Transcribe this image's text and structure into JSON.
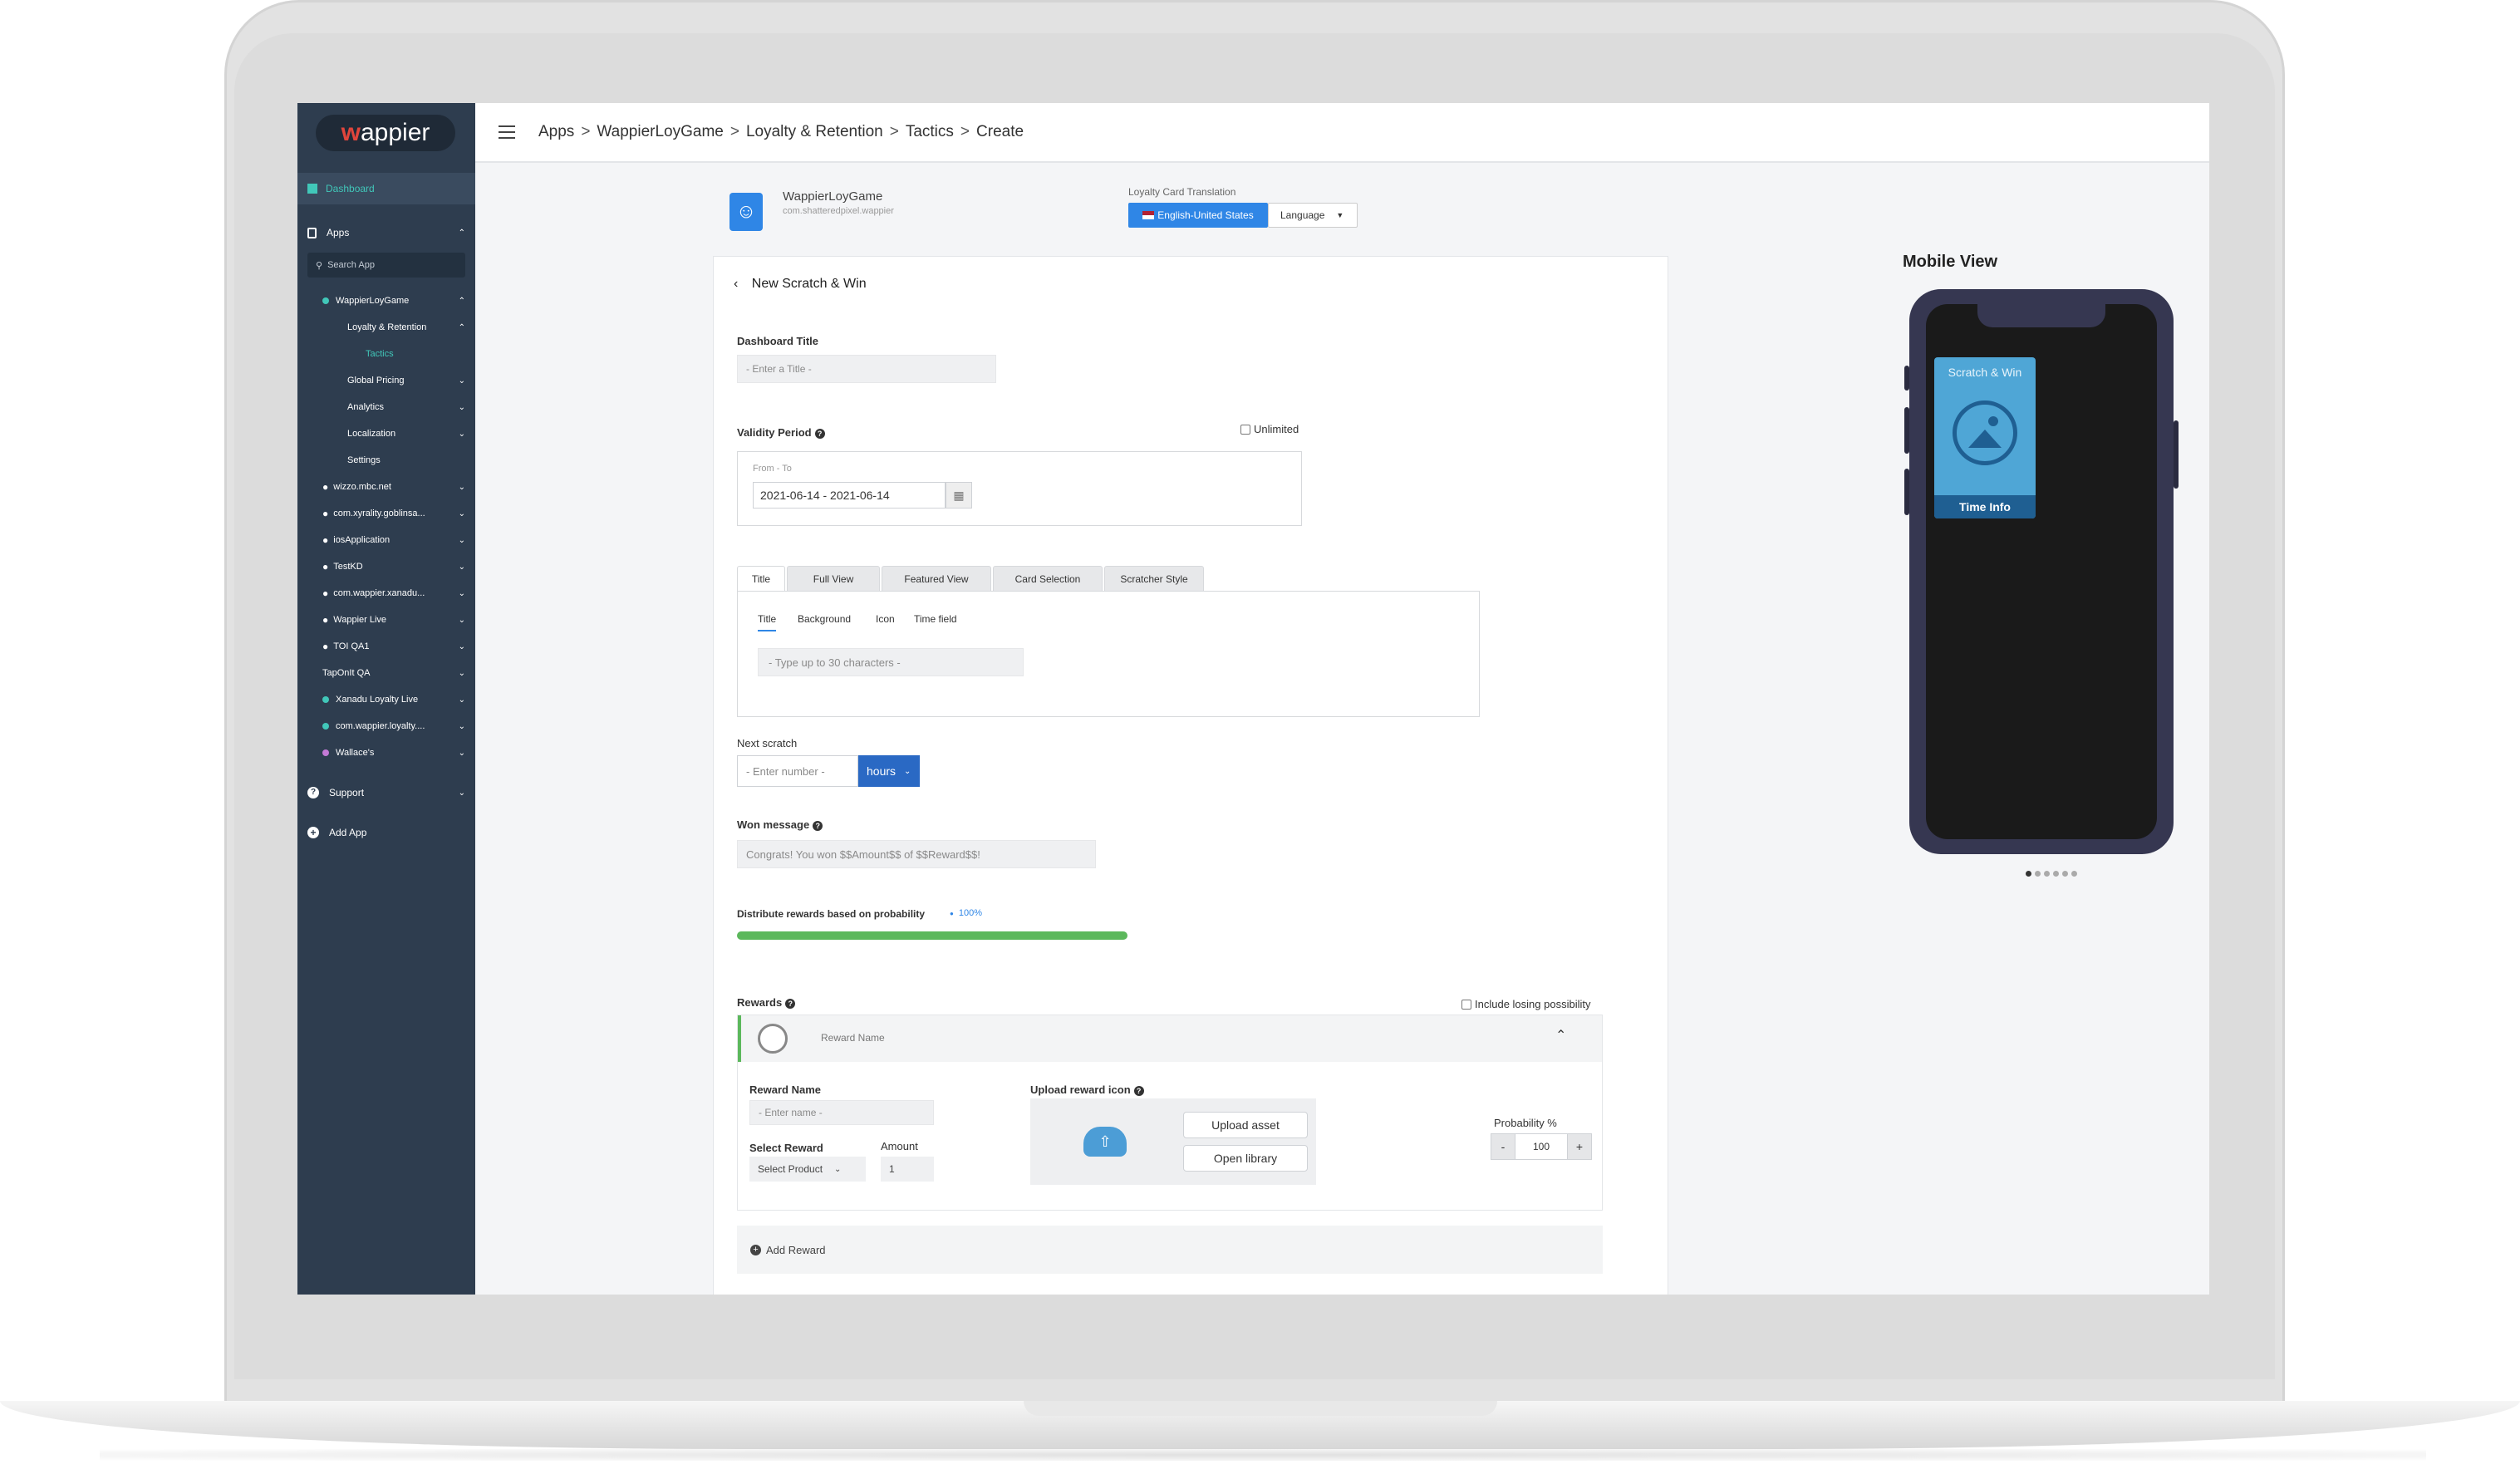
{
  "sidebar": {
    "logo": "wappier",
    "dashboard": "Dashboard",
    "apps": "Apps",
    "search_placeholder": "Search App",
    "apps_list": [
      {
        "label": "WappierLoyGame"
      },
      {
        "label": "Loyalty & Retention"
      },
      {
        "label": "Tactics"
      },
      {
        "label": "Global Pricing"
      },
      {
        "label": "Analytics"
      },
      {
        "label": "Localization"
      },
      {
        "label": "Settings"
      },
      {
        "label": "wizzo.mbc.net"
      },
      {
        "label": "com.xyrality.goblinsa..."
      },
      {
        "label": "iosApplication"
      },
      {
        "label": "TestKD"
      },
      {
        "label": "com.wappier.xanadu..."
      },
      {
        "label": "Wappier Live"
      },
      {
        "label": "TOI QA1"
      },
      {
        "label": "TapOnIt QA"
      },
      {
        "label": "Xanadu Loyalty Live"
      },
      {
        "label": "com.wappier.loyalty...."
      },
      {
        "label": "Wallace's"
      }
    ],
    "support": "Support",
    "add_app": "Add App"
  },
  "breadcrumb": [
    "Apps",
    "WappierLoyGame",
    "Loyalty & Retention",
    "Tactics",
    "Create"
  ],
  "breadcrumb_sep": ">",
  "app": {
    "name": "WappierLoyGame",
    "package": "com.shatteredpixel.wappier"
  },
  "translation": {
    "label": "Loyalty Card Translation",
    "current": "English-United States",
    "dropdown": "Language"
  },
  "form": {
    "back_title": "New Scratch & Win",
    "dashboard_title_label": "Dashboard Title",
    "dashboard_title_placeholder": "- Enter a Title -",
    "validity_label": "Validity Period",
    "unlimited": "Unlimited",
    "from_to": "From - To",
    "date_range": "2021-06-14 - 2021-06-14",
    "tabs": [
      "Title",
      "Full View",
      "Featured View",
      "Card Selection",
      "Scratcher Style"
    ],
    "subtabs": [
      "Title",
      "Background",
      "Icon",
      "Time field"
    ],
    "title_placeholder": "- Type up to 30 characters -",
    "next_scratch_label": "Next scratch",
    "next_scratch_placeholder": "- Enter number -",
    "next_scratch_unit": "hours",
    "won_message_label": "Won message",
    "won_message_placeholder": "Congrats! You won $$Amount$$ of $$Reward$$!",
    "distribute_label": "Distribute rewards based on probability",
    "distribute_value": "100%",
    "distribute_fraction": 1.0,
    "rewards_label": "Rewards",
    "include_losing": "Include losing possibility",
    "reward_header_name": "Reward Name",
    "reward_name_label": "Reward Name",
    "reward_name_placeholder": "- Enter name -",
    "select_reward_label": "Select Reward",
    "select_reward_value": "Select Product",
    "amount_label": "Amount",
    "amount_value": "1",
    "upload_icon_label": "Upload reward icon",
    "upload_asset": "Upload asset",
    "open_library": "Open library",
    "probability_label": "Probability %",
    "probability_value": "100",
    "minus": "-",
    "plus": "+",
    "add_reward": "Add Reward"
  },
  "mobile": {
    "title": "Mobile View",
    "card_title": "Scratch & Win",
    "card_footer": "Time Info",
    "pages": 6,
    "active_page": 1
  },
  "colors": {
    "sidebar": "#2e3d4f",
    "accent": "#2f86e6",
    "teal": "#41c7b9",
    "progress": "#5cb85c",
    "phone_body": "#363751",
    "card_blue": "#4fa6d6"
  }
}
